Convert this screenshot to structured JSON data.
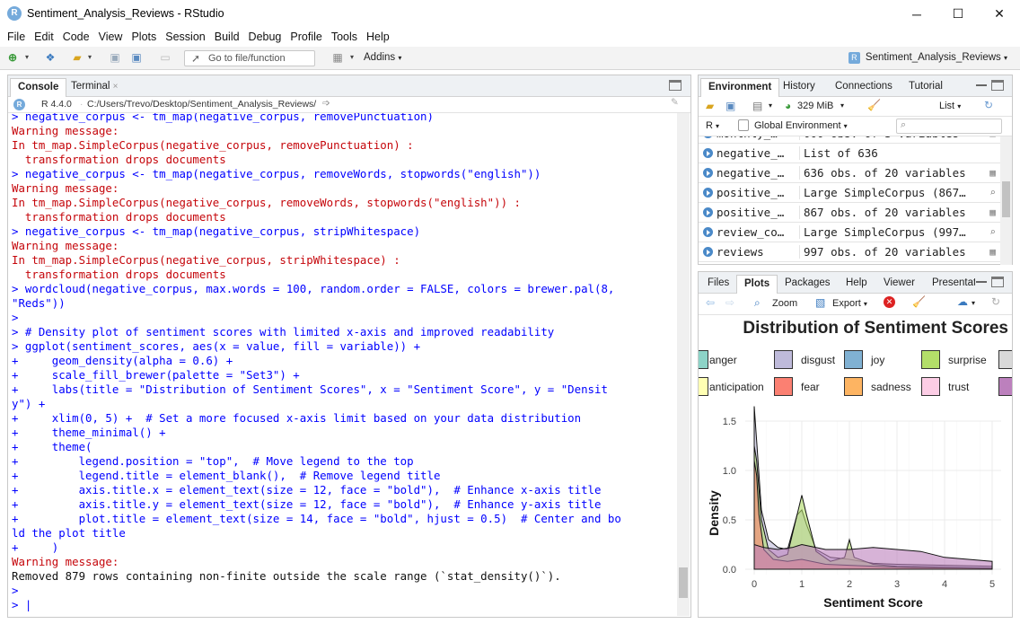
{
  "window": {
    "title": "Sentiment_Analysis_Reviews - RStudio",
    "app_letter": "R",
    "minimize": "─",
    "maximize": "☐",
    "close": "✕"
  },
  "menu": [
    "File",
    "Edit",
    "Code",
    "View",
    "Plots",
    "Session",
    "Build",
    "Debug",
    "Profile",
    "Tools",
    "Help"
  ],
  "toolbar": {
    "goto_placeholder": "Go to file/function",
    "addins_label": "Addins",
    "project_label": "Sentiment_Analysis_Reviews"
  },
  "left_pane": {
    "tabs": [
      "Console",
      "Terminal"
    ],
    "r_version": "R 4.4.0",
    "path": "C:/Users/Trevo/Desktop/Sentiment_Analysis_Reviews/",
    "lines": [
      {
        "t": "cmd",
        "s": "> negative_corpus <- tm_map(negative_corpus, removePunctuation)"
      },
      {
        "t": "err",
        "s": "Warning message:"
      },
      {
        "t": "err",
        "s": "In tm_map.SimpleCorpus(negative_corpus, removePunctuation) :"
      },
      {
        "t": "err",
        "s": "  transformation drops documents"
      },
      {
        "t": "cmd",
        "s": "> negative_corpus <- tm_map(negative_corpus, removeWords, stopwords(\"english\"))"
      },
      {
        "t": "err",
        "s": "Warning message:"
      },
      {
        "t": "err",
        "s": "In tm_map.SimpleCorpus(negative_corpus, removeWords, stopwords(\"english\")) :"
      },
      {
        "t": "err",
        "s": "  transformation drops documents"
      },
      {
        "t": "cmd",
        "s": "> negative_corpus <- tm_map(negative_corpus, stripWhitespace)"
      },
      {
        "t": "err",
        "s": "Warning message:"
      },
      {
        "t": "err",
        "s": "In tm_map.SimpleCorpus(negative_corpus, stripWhitespace) :"
      },
      {
        "t": "err",
        "s": "  transformation drops documents"
      },
      {
        "t": "cmd",
        "s": "> wordcloud(negative_corpus, max.words = 100, random.order = FALSE, colors = brewer.pal(8,"
      },
      {
        "t": "cmd",
        "s": "\"Reds\"))"
      },
      {
        "t": "cmd",
        "s": ">"
      },
      {
        "t": "cmd",
        "s": "> # Density plot of sentiment scores with limited x-axis and improved readability"
      },
      {
        "t": "cmd",
        "s": "> ggplot(sentiment_scores, aes(x = value, fill = variable)) +"
      },
      {
        "t": "cmd",
        "s": "+     geom_density(alpha = 0.6) +"
      },
      {
        "t": "cmd",
        "s": "+     scale_fill_brewer(palette = \"Set3\") +"
      },
      {
        "t": "cmd",
        "s": "+     labs(title = \"Distribution of Sentiment Scores\", x = \"Sentiment Score\", y = \"Densit"
      },
      {
        "t": "cmd",
        "s": "y\") +"
      },
      {
        "t": "cmd",
        "s": "+     xlim(0, 5) +  # Set a more focused x-axis limit based on your data distribution"
      },
      {
        "t": "cmd",
        "s": "+     theme_minimal() +"
      },
      {
        "t": "cmd",
        "s": "+     theme("
      },
      {
        "t": "cmd",
        "s": "+         legend.position = \"top\",  # Move legend to the top"
      },
      {
        "t": "cmd",
        "s": "+         legend.title = element_blank(),  # Remove legend title"
      },
      {
        "t": "cmd",
        "s": "+         axis.title.x = element_text(size = 12, face = \"bold\"),  # Enhance x-axis title"
      },
      {
        "t": "cmd",
        "s": "+         axis.title.y = element_text(size = 12, face = \"bold\"),  # Enhance y-axis title"
      },
      {
        "t": "cmd",
        "s": "+         plot.title = element_text(size = 14, face = \"bold\", hjust = 0.5)  # Center and bo"
      },
      {
        "t": "cmd",
        "s": "ld the plot title"
      },
      {
        "t": "cmd",
        "s": "+     )"
      },
      {
        "t": "err",
        "s": "Warning message:"
      },
      {
        "t": "out",
        "s": "Removed 879 rows containing non-finite outside the scale range (`stat_density()`)."
      },
      {
        "t": "cmd",
        "s": ">"
      },
      {
        "t": "cmd",
        "s": "> |"
      }
    ]
  },
  "right_top": {
    "tabs": [
      "Environment",
      "History",
      "Connections",
      "Tutorial"
    ],
    "memory": "329 MiB",
    "list_label": "List",
    "r_label": "R",
    "global_env": "Global Environment",
    "rows": [
      {
        "name": "monthly_…",
        "value": "000 obs. of 3 variables",
        "kind": "table"
      },
      {
        "name": "negative_…",
        "value": "List of  636",
        "kind": "none"
      },
      {
        "name": "negative_…",
        "value": "636 obs. of 20 variables",
        "kind": "table"
      },
      {
        "name": "positive_…",
        "value": "Large SimpleCorpus (867…",
        "kind": "search"
      },
      {
        "name": "positive_…",
        "value": "867 obs. of 20 variables",
        "kind": "table"
      },
      {
        "name": "review_co…",
        "value": "Large SimpleCorpus (997…",
        "kind": "search"
      },
      {
        "name": "reviews",
        "value": "997 obs. of 20 variables",
        "kind": "table"
      }
    ]
  },
  "right_bottom": {
    "tabs": [
      "Files",
      "Plots",
      "Packages",
      "Help",
      "Viewer",
      "Presentati"
    ],
    "zoom_label": "Zoom",
    "export_label": "Export"
  },
  "chart_data": {
    "type": "area",
    "title": "Distribution of Sentiment Scores",
    "xlabel": "Sentiment Score",
    "ylabel": "Density",
    "xlim": [
      0,
      5
    ],
    "ylim": [
      0,
      1.7
    ],
    "x_ticks": [
      0,
      1,
      2,
      3,
      4,
      5
    ],
    "y_ticks": [
      0.0,
      0.5,
      1.0,
      1.5
    ],
    "y_tick_labels": [
      "0.0",
      "0.5",
      "1.0",
      "1.5"
    ],
    "legend_position": "top",
    "legend": [
      {
        "name": "anger",
        "color": "#8DD3C7"
      },
      {
        "name": "disgust",
        "color": "#BEBADA"
      },
      {
        "name": "joy",
        "color": "#80B1D3"
      },
      {
        "name": "surprise",
        "color": "#B3DE69"
      },
      {
        "name": "anticipation",
        "color": "#FFFFB3"
      },
      {
        "name": "fear",
        "color": "#FB8072"
      },
      {
        "name": "sadness",
        "color": "#FDB462"
      },
      {
        "name": "trust",
        "color": "#FCCDE5"
      },
      {
        "name": "",
        "color": "#D9D9D9"
      },
      {
        "name": "",
        "color": "#BC80BD"
      }
    ],
    "series": [
      {
        "name": "disgust",
        "color": "#BEBADA",
        "x": [
          0,
          0.05,
          0.15,
          0.3,
          0.5,
          0.7,
          0.9,
          1.0,
          1.1,
          1.3,
          1.6,
          2.0,
          2.5,
          3,
          4,
          5
        ],
        "y": [
          1.65,
          1.3,
          0.6,
          0.3,
          0.22,
          0.2,
          0.55,
          0.6,
          0.45,
          0.2,
          0.12,
          0.1,
          0.06,
          0.05,
          0.04,
          0.03
        ]
      },
      {
        "name": "surprise",
        "color": "#B3DE69",
        "x": [
          0,
          0.05,
          0.15,
          0.3,
          0.5,
          0.7,
          0.9,
          1.0,
          1.1,
          1.3,
          1.6,
          1.9,
          2.0,
          2.1,
          2.5,
          3,
          4,
          5
        ],
        "y": [
          1.25,
          1.1,
          0.5,
          0.2,
          0.12,
          0.15,
          0.55,
          0.75,
          0.55,
          0.18,
          0.08,
          0.12,
          0.3,
          0.12,
          0.05,
          0.03,
          0.02,
          0.01
        ]
      },
      {
        "name": "fear",
        "color": "#FB8072",
        "x": [
          0,
          0.05,
          0.1,
          0.2,
          0.4,
          0.7,
          1.0,
          1.5,
          2.0,
          3,
          5
        ],
        "y": [
          1.1,
          0.95,
          0.55,
          0.2,
          0.1,
          0.08,
          0.1,
          0.05,
          0.04,
          0.02,
          0.01
        ]
      },
      {
        "name": "trust",
        "color": "#BC80BD",
        "x": [
          0,
          0.2,
          0.5,
          0.8,
          1.0,
          1.5,
          2.0,
          2.5,
          3.0,
          3.5,
          4.0,
          4.5,
          5.0
        ],
        "y": [
          0.25,
          0.22,
          0.2,
          0.22,
          0.25,
          0.2,
          0.2,
          0.22,
          0.2,
          0.18,
          0.12,
          0.1,
          0.08
        ]
      }
    ]
  }
}
